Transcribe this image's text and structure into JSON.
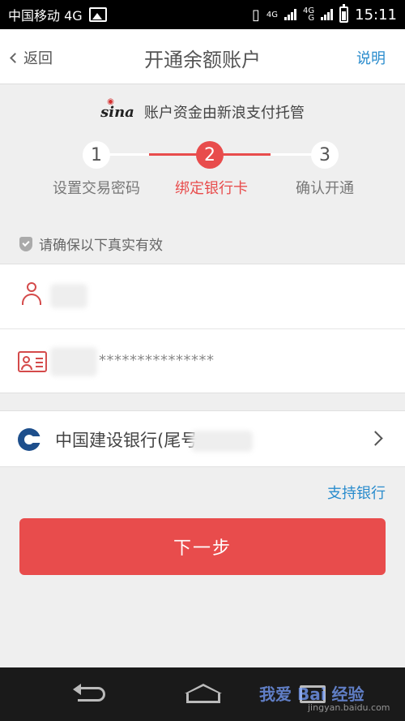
{
  "status_bar": {
    "carrier": "中国移动 4G",
    "time": "15:11",
    "net_label_top": "4G",
    "net_label_mid": "4G",
    "net_label_bot": "G"
  },
  "nav": {
    "back_label": "返回",
    "title": "开通余额账户",
    "help_label": "说明"
  },
  "sina": {
    "logo_text": "sina",
    "note": "账户资金由新浪支付托管"
  },
  "steps": [
    {
      "number": "1",
      "label": "设置交易密码",
      "state": "done"
    },
    {
      "number": "2",
      "label": "绑定银行卡",
      "state": "active"
    },
    {
      "number": "3",
      "label": "确认开通",
      "state": "pending"
    }
  ],
  "hint": "请确保以下真实有效",
  "form": {
    "id_masked": "***************"
  },
  "bank": {
    "name": "中国建设银行(尾号"
  },
  "support_link": "支持银行",
  "next_button": "下一步",
  "watermark": {
    "main": "我爱 Bai 经验",
    "sub": "jingyan.baidu.com"
  },
  "colors": {
    "accent": "#e84c4c",
    "link": "#2a8ccd",
    "bank_brand": "#1e4f8c"
  }
}
